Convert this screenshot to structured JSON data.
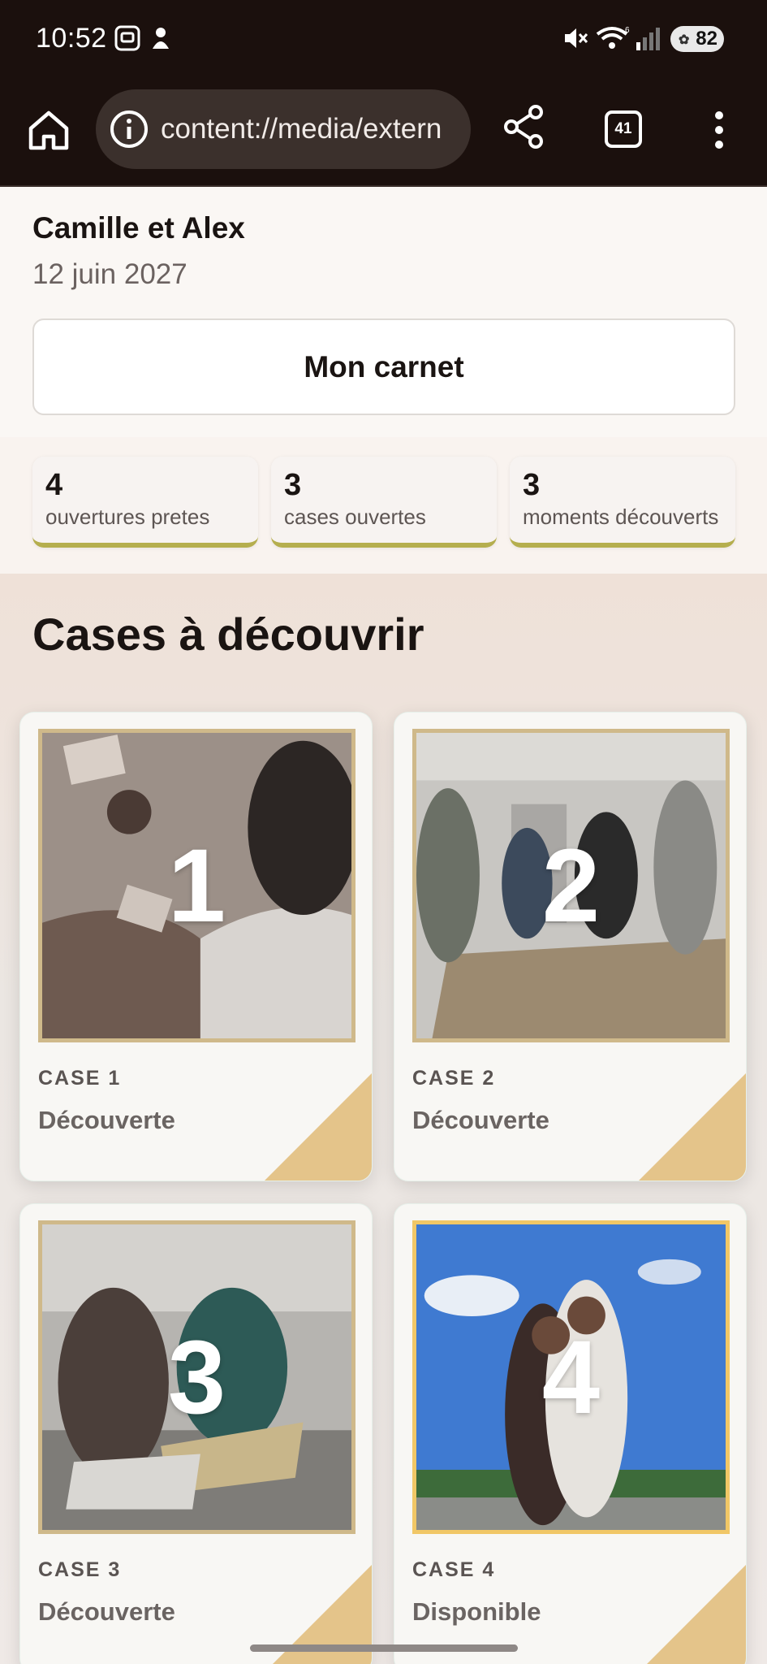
{
  "status_bar": {
    "time": "10:52",
    "battery": "82",
    "icons": [
      "screenshot-icon",
      "notification-icon",
      "mute-icon",
      "wifi-icon",
      "signal-icon",
      "battery-icon"
    ]
  },
  "browser": {
    "url": "content://media/extern",
    "tab_count": "41"
  },
  "header": {
    "couple": "Camille et Alex",
    "date": "12 juin 2027",
    "button_label": "Mon carnet"
  },
  "stats": [
    {
      "value": "4",
      "label": "ouvertures pretes"
    },
    {
      "value": "3",
      "label": "cases ouvertes"
    },
    {
      "value": "3",
      "label": "moments découverts"
    }
  ],
  "section": {
    "title": "Cases à découvrir"
  },
  "cards": [
    {
      "number": "1",
      "case_label": "CASE 1",
      "status": "Découverte"
    },
    {
      "number": "2",
      "case_label": "CASE 2",
      "status": "Découverte"
    },
    {
      "number": "3",
      "case_label": "CASE 3",
      "status": "Découverte"
    },
    {
      "number": "4",
      "case_label": "CASE 4",
      "status": "Disponible"
    }
  ],
  "colors": {
    "chrome": "#1b100d",
    "accent_gold": "#e4c48a",
    "stat_underline": "#b5ae4e"
  }
}
